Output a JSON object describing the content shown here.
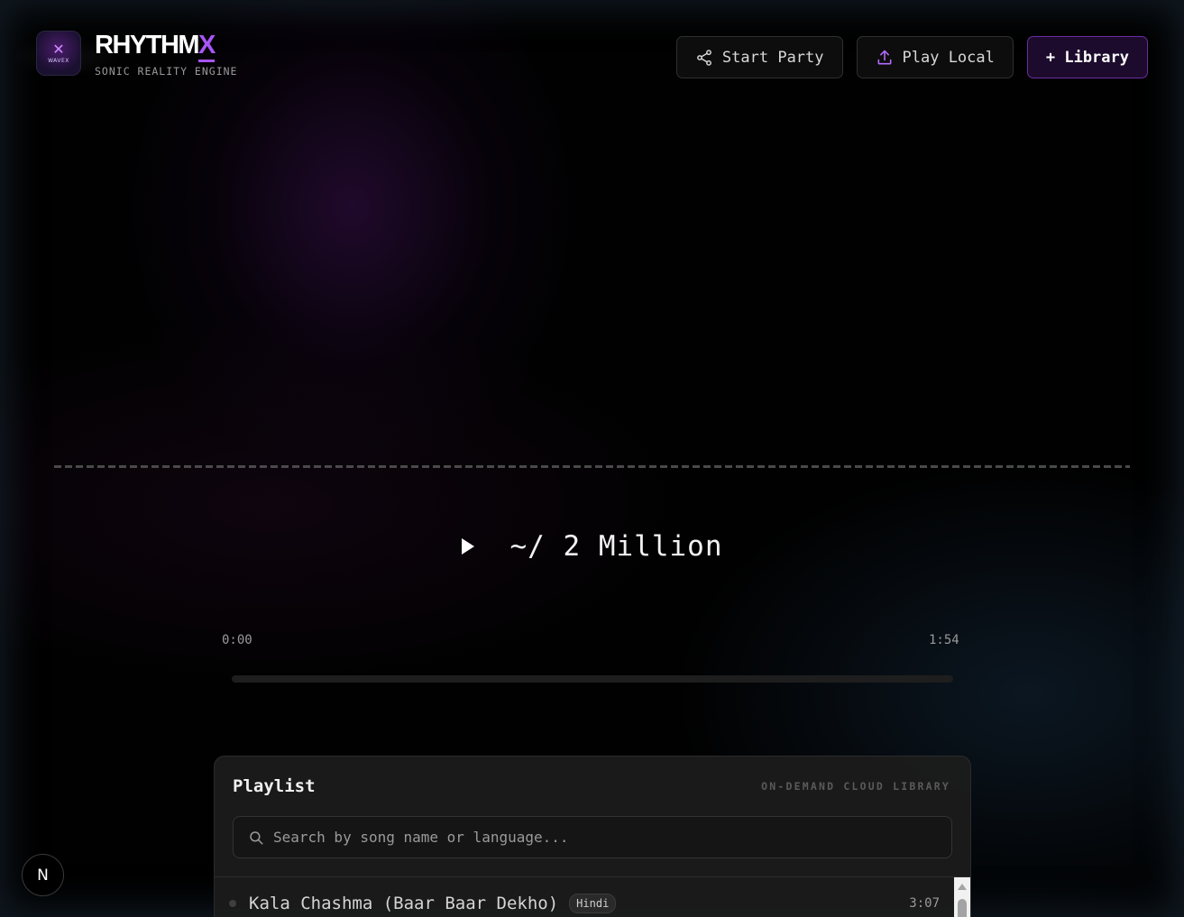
{
  "brand": {
    "logo_mark": "✕",
    "logo_text": "WAVEX",
    "title_main": "RHYTHM",
    "title_accent": "X",
    "subtitle": "SONIC REALITY ENGINE",
    "accent_color": "#a855f7"
  },
  "nav": {
    "start_party": "Start Party",
    "play_local": "Play Local",
    "library": "+ Library",
    "icons": [
      "share-icon",
      "upload-icon"
    ]
  },
  "player": {
    "play_icon": "play-icon",
    "now_playing": "~/ 2 Million",
    "current_time": "0:00",
    "duration": "1:54",
    "progress_percent": 0
  },
  "playlist": {
    "title": "Playlist",
    "tag": "ON-DEMAND CLOUD LIBRARY",
    "search_placeholder": "Search by song name or language...",
    "tracks": [
      {
        "name": "Kala Chashma (Baar Baar Dekho)",
        "language": "Hindi",
        "duration": "3:07"
      }
    ]
  },
  "dev_badge": "N"
}
